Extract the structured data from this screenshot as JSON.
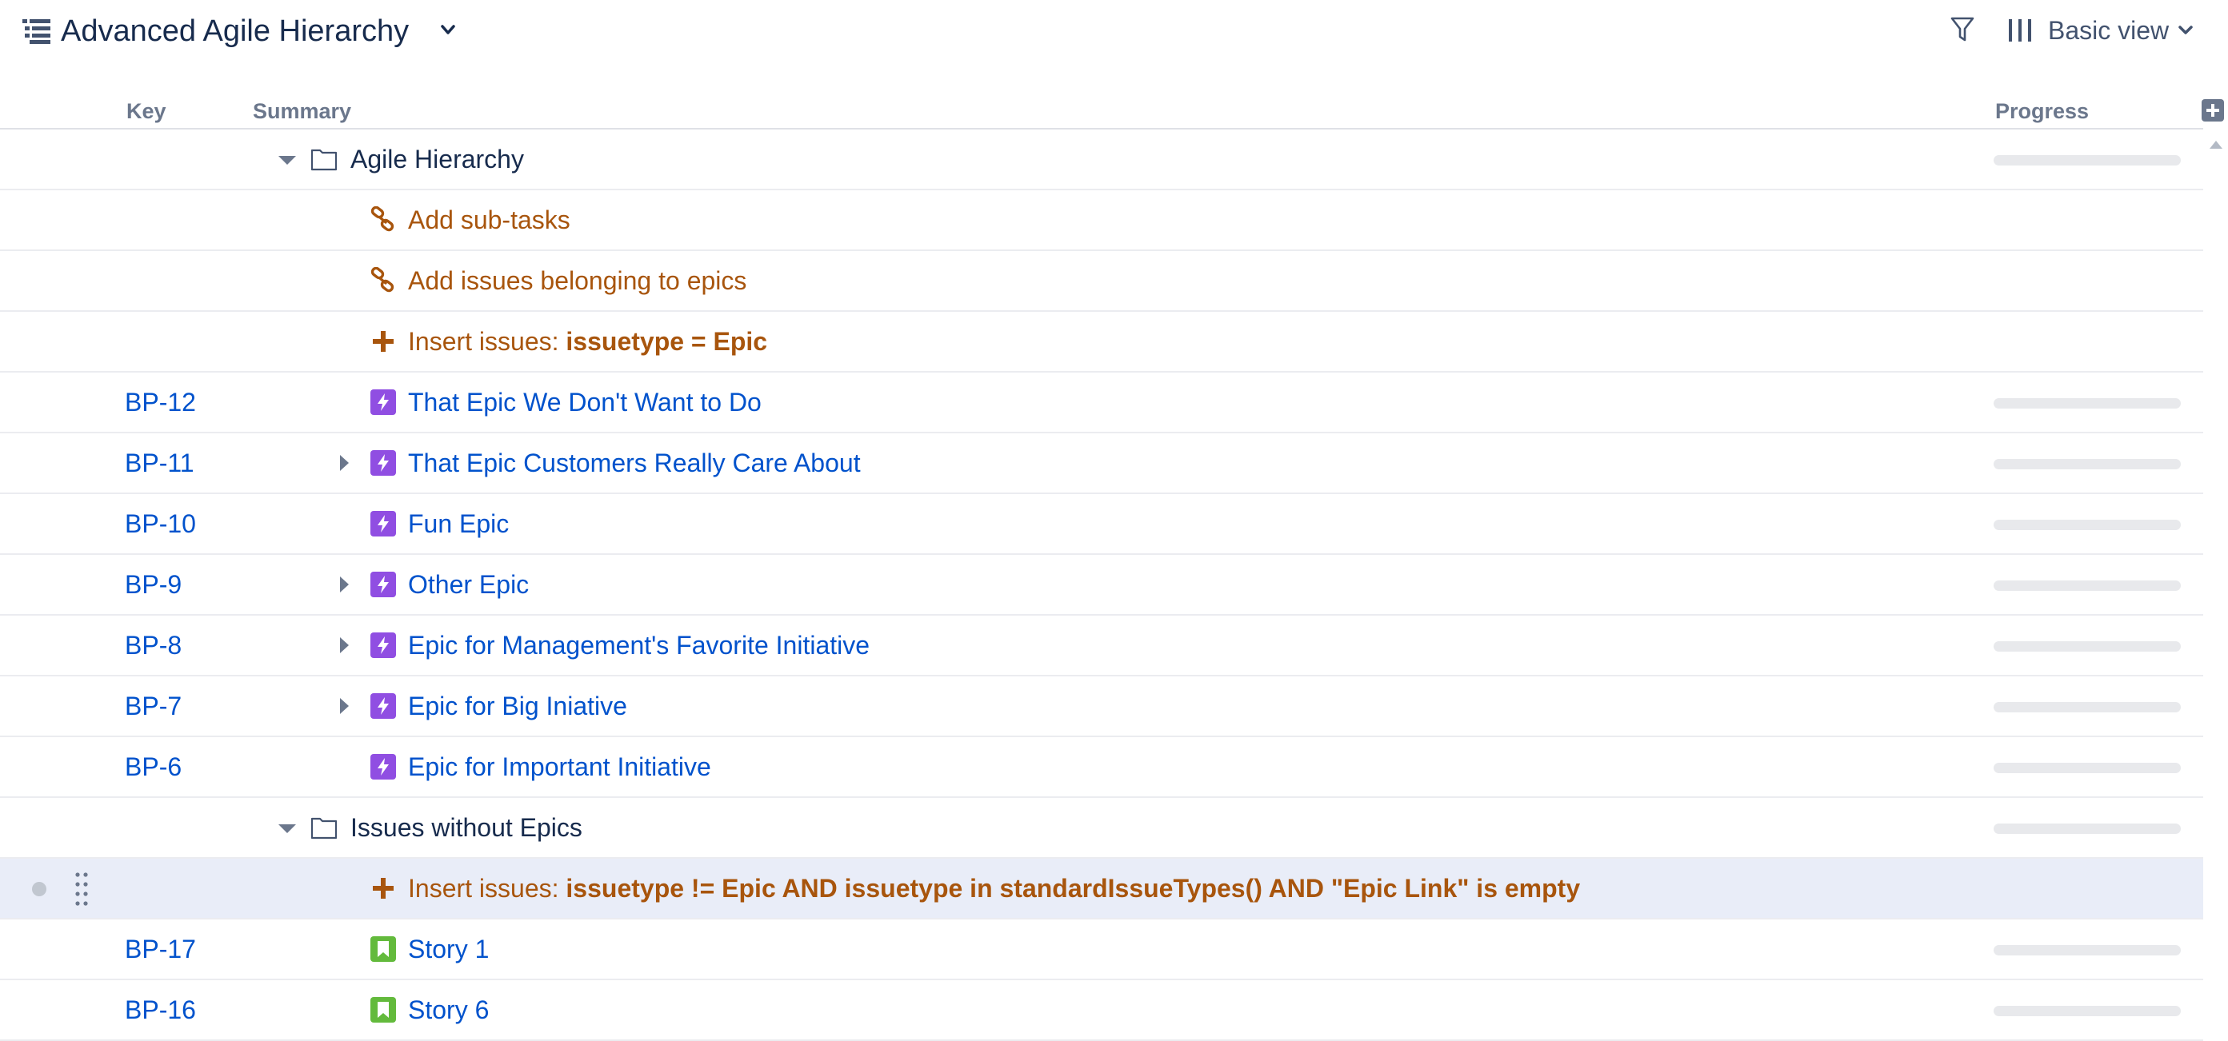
{
  "header": {
    "title": "Advanced Agile Hierarchy",
    "view_label": "Basic view",
    "icons": {
      "structure": "structure-icon",
      "filter": "filter-icon",
      "columns": "columns-icon",
      "chevron": "chevron-down-icon"
    }
  },
  "columns": {
    "key": "Key",
    "summary": "Summary",
    "progress": "Progress"
  },
  "colors": {
    "link": "#0052cc",
    "generator": "#a8550d",
    "epic": "#904ee2",
    "story": "#63ba3c",
    "selected_row": "#e9edf8"
  },
  "rows": [
    {
      "key": "",
      "type": "folder",
      "toggle": "down",
      "label": "Agile Hierarchy",
      "progress": true
    },
    {
      "key": "",
      "type": "extend",
      "label": "Add sub-tasks",
      "progress": false
    },
    {
      "key": "",
      "type": "extend",
      "label": "Add issues belonging to epics",
      "progress": false
    },
    {
      "key": "",
      "type": "insert",
      "prefix": "Insert issues: ",
      "label": "issuetype = Epic",
      "progress": false
    },
    {
      "key": "BP-12",
      "type": "epic",
      "label": "That Epic We Don't Want to Do",
      "progress": true
    },
    {
      "key": "BP-11",
      "type": "epic",
      "toggle": "right",
      "label": "That Epic Customers Really Care About",
      "progress": true
    },
    {
      "key": "BP-10",
      "type": "epic",
      "label": "Fun Epic",
      "progress": true
    },
    {
      "key": "BP-9",
      "type": "epic",
      "toggle": "right",
      "label": "Other Epic",
      "progress": true
    },
    {
      "key": "BP-8",
      "type": "epic",
      "toggle": "right",
      "label": "Epic for Management's Favorite Initiative",
      "progress": true
    },
    {
      "key": "BP-7",
      "type": "epic",
      "toggle": "right",
      "label": "Epic for Big Iniative",
      "progress": true
    },
    {
      "key": "BP-6",
      "type": "epic",
      "label": "Epic for Important Initiative",
      "progress": true
    },
    {
      "key": "",
      "type": "folder",
      "toggle": "down",
      "label": "Issues without Epics",
      "progress": true
    },
    {
      "key": "",
      "type": "insert",
      "prefix": "Insert issues: ",
      "label": "issuetype != Epic AND issuetype in standardIssueTypes() AND \"Epic Link\" is empty",
      "progress": false,
      "selected": true
    },
    {
      "key": "BP-17",
      "type": "story",
      "label": "Story 1",
      "progress": true
    },
    {
      "key": "BP-16",
      "type": "story",
      "label": "Story 6",
      "progress": true
    }
  ]
}
